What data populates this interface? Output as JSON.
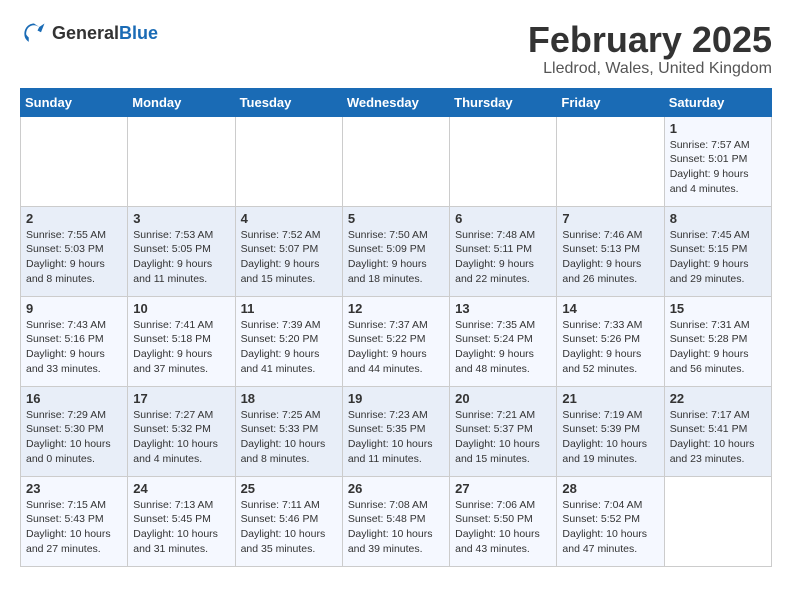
{
  "logo": {
    "general": "General",
    "blue": "Blue"
  },
  "title": "February 2025",
  "subtitle": "Lledrod, Wales, United Kingdom",
  "days_of_week": [
    "Sunday",
    "Monday",
    "Tuesday",
    "Wednesday",
    "Thursday",
    "Friday",
    "Saturday"
  ],
  "weeks": [
    [
      {
        "day": "",
        "info": ""
      },
      {
        "day": "",
        "info": ""
      },
      {
        "day": "",
        "info": ""
      },
      {
        "day": "",
        "info": ""
      },
      {
        "day": "",
        "info": ""
      },
      {
        "day": "",
        "info": ""
      },
      {
        "day": "1",
        "info": "Sunrise: 7:57 AM\nSunset: 5:01 PM\nDaylight: 9 hours and 4 minutes."
      }
    ],
    [
      {
        "day": "2",
        "info": "Sunrise: 7:55 AM\nSunset: 5:03 PM\nDaylight: 9 hours and 8 minutes."
      },
      {
        "day": "3",
        "info": "Sunrise: 7:53 AM\nSunset: 5:05 PM\nDaylight: 9 hours and 11 minutes."
      },
      {
        "day": "4",
        "info": "Sunrise: 7:52 AM\nSunset: 5:07 PM\nDaylight: 9 hours and 15 minutes."
      },
      {
        "day": "5",
        "info": "Sunrise: 7:50 AM\nSunset: 5:09 PM\nDaylight: 9 hours and 18 minutes."
      },
      {
        "day": "6",
        "info": "Sunrise: 7:48 AM\nSunset: 5:11 PM\nDaylight: 9 hours and 22 minutes."
      },
      {
        "day": "7",
        "info": "Sunrise: 7:46 AM\nSunset: 5:13 PM\nDaylight: 9 hours and 26 minutes."
      },
      {
        "day": "8",
        "info": "Sunrise: 7:45 AM\nSunset: 5:15 PM\nDaylight: 9 hours and 29 minutes."
      }
    ],
    [
      {
        "day": "9",
        "info": "Sunrise: 7:43 AM\nSunset: 5:16 PM\nDaylight: 9 hours and 33 minutes."
      },
      {
        "day": "10",
        "info": "Sunrise: 7:41 AM\nSunset: 5:18 PM\nDaylight: 9 hours and 37 minutes."
      },
      {
        "day": "11",
        "info": "Sunrise: 7:39 AM\nSunset: 5:20 PM\nDaylight: 9 hours and 41 minutes."
      },
      {
        "day": "12",
        "info": "Sunrise: 7:37 AM\nSunset: 5:22 PM\nDaylight: 9 hours and 44 minutes."
      },
      {
        "day": "13",
        "info": "Sunrise: 7:35 AM\nSunset: 5:24 PM\nDaylight: 9 hours and 48 minutes."
      },
      {
        "day": "14",
        "info": "Sunrise: 7:33 AM\nSunset: 5:26 PM\nDaylight: 9 hours and 52 minutes."
      },
      {
        "day": "15",
        "info": "Sunrise: 7:31 AM\nSunset: 5:28 PM\nDaylight: 9 hours and 56 minutes."
      }
    ],
    [
      {
        "day": "16",
        "info": "Sunrise: 7:29 AM\nSunset: 5:30 PM\nDaylight: 10 hours and 0 minutes."
      },
      {
        "day": "17",
        "info": "Sunrise: 7:27 AM\nSunset: 5:32 PM\nDaylight: 10 hours and 4 minutes."
      },
      {
        "day": "18",
        "info": "Sunrise: 7:25 AM\nSunset: 5:33 PM\nDaylight: 10 hours and 8 minutes."
      },
      {
        "day": "19",
        "info": "Sunrise: 7:23 AM\nSunset: 5:35 PM\nDaylight: 10 hours and 11 minutes."
      },
      {
        "day": "20",
        "info": "Sunrise: 7:21 AM\nSunset: 5:37 PM\nDaylight: 10 hours and 15 minutes."
      },
      {
        "day": "21",
        "info": "Sunrise: 7:19 AM\nSunset: 5:39 PM\nDaylight: 10 hours and 19 minutes."
      },
      {
        "day": "22",
        "info": "Sunrise: 7:17 AM\nSunset: 5:41 PM\nDaylight: 10 hours and 23 minutes."
      }
    ],
    [
      {
        "day": "23",
        "info": "Sunrise: 7:15 AM\nSunset: 5:43 PM\nDaylight: 10 hours and 27 minutes."
      },
      {
        "day": "24",
        "info": "Sunrise: 7:13 AM\nSunset: 5:45 PM\nDaylight: 10 hours and 31 minutes."
      },
      {
        "day": "25",
        "info": "Sunrise: 7:11 AM\nSunset: 5:46 PM\nDaylight: 10 hours and 35 minutes."
      },
      {
        "day": "26",
        "info": "Sunrise: 7:08 AM\nSunset: 5:48 PM\nDaylight: 10 hours and 39 minutes."
      },
      {
        "day": "27",
        "info": "Sunrise: 7:06 AM\nSunset: 5:50 PM\nDaylight: 10 hours and 43 minutes."
      },
      {
        "day": "28",
        "info": "Sunrise: 7:04 AM\nSunset: 5:52 PM\nDaylight: 10 hours and 47 minutes."
      },
      {
        "day": "",
        "info": ""
      }
    ]
  ]
}
